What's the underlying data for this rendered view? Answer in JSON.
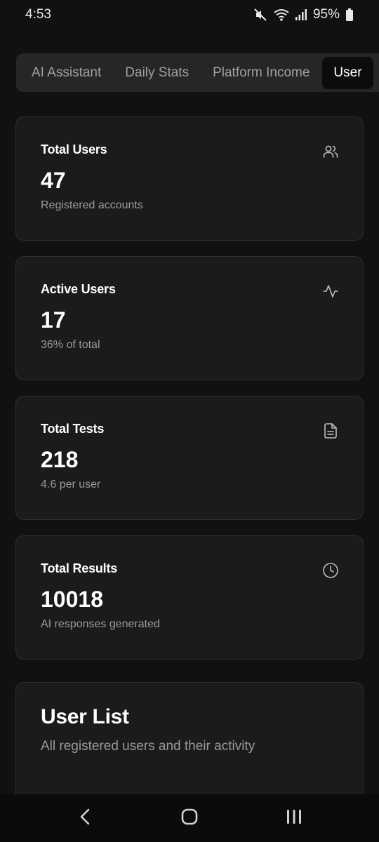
{
  "status_bar": {
    "time": "4:53",
    "battery": "95%",
    "icons": [
      "mute-icon",
      "wifi-icon",
      "signal-icon",
      "battery-icon"
    ]
  },
  "tabs": [
    {
      "label": "AI Assistant",
      "active": false
    },
    {
      "label": "Daily Stats",
      "active": false
    },
    {
      "label": "Platform Income",
      "active": false
    },
    {
      "label": "User",
      "active": true
    }
  ],
  "cards": [
    {
      "title": "Total Users",
      "value": "47",
      "subtitle": "Registered accounts",
      "icon": "users-icon"
    },
    {
      "title": "Active Users",
      "value": "17",
      "subtitle": "36% of total",
      "icon": "activity-icon"
    },
    {
      "title": "Total Tests",
      "value": "218",
      "subtitle": "4.6 per user",
      "icon": "document-icon"
    },
    {
      "title": "Total Results",
      "value": "10018",
      "subtitle": "AI responses generated",
      "icon": "clock-icon"
    }
  ],
  "user_list": {
    "title": "User List",
    "subtitle": "All registered users and their activity"
  },
  "nav_bar": {
    "buttons": [
      "back-icon",
      "home-icon",
      "recents-icon"
    ]
  },
  "colors": {
    "background": "#111111",
    "card": "#1b1b1b",
    "card_border": "#2e2e2e",
    "tab_bar": "#262626",
    "active_tab": "#0c0c0c",
    "muted_text": "#9a9a9a"
  }
}
